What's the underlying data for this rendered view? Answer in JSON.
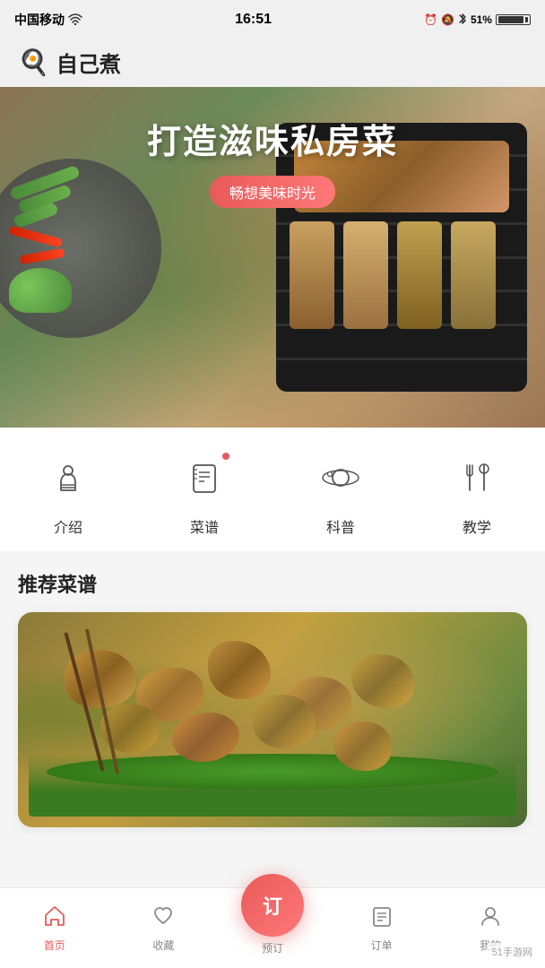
{
  "statusBar": {
    "carrier": "中国移动",
    "wifi": true,
    "time": "16:51",
    "battery": "51%"
  },
  "header": {
    "iconLabel": "🍳",
    "title": "自己煮"
  },
  "hero": {
    "mainTitle": "打造滋味私房菜",
    "subtitle": "畅想美味时光"
  },
  "categories": [
    {
      "id": "intro",
      "icon": "chef",
      "label": "介绍",
      "badge": false
    },
    {
      "id": "recipes",
      "icon": "recipe",
      "label": "菜谱",
      "badge": true
    },
    {
      "id": "science",
      "icon": "planet",
      "label": "科普",
      "badge": false
    },
    {
      "id": "tutorial",
      "icon": "utensils",
      "label": "教学",
      "badge": false
    }
  ],
  "recommended": {
    "sectionTitle": "推荐菜谱"
  },
  "bottomNav": [
    {
      "id": "home",
      "icon": "home",
      "label": "首页",
      "active": true
    },
    {
      "id": "favorites",
      "icon": "heart",
      "label": "收藏",
      "active": false
    },
    {
      "id": "order",
      "icon": "order",
      "label": "预订",
      "active": false,
      "isCenter": true
    },
    {
      "id": "orders",
      "icon": "list",
      "label": "订单",
      "active": false
    },
    {
      "id": "profile",
      "icon": "user",
      "label": "我的",
      "active": false
    }
  ],
  "orderButton": {
    "text": "订",
    "label": "预订"
  },
  "watermark": {
    "text": "51手游网",
    "url": "www.51danye.com"
  }
}
